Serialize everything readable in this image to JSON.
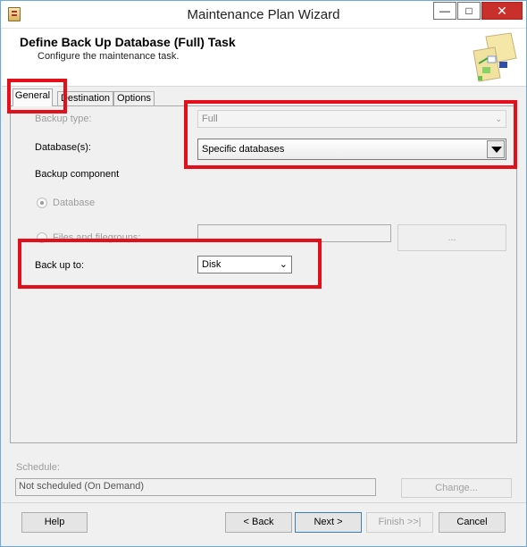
{
  "window": {
    "title": "Maintenance Plan Wizard",
    "minimize_glyph": "—",
    "maximize_glyph": "□",
    "close_glyph": "✕"
  },
  "header": {
    "title": "Define Back Up Database (Full) Task",
    "subtitle": "Configure the maintenance task."
  },
  "tabs": [
    {
      "label": "General",
      "selected": true
    },
    {
      "label": "Destination",
      "selected": false
    },
    {
      "label": "Options",
      "selected": false
    }
  ],
  "general": {
    "backup_type_label": "Backup type:",
    "backup_type_value": "Full",
    "databases_label": "Database(s):",
    "databases_value": "Specific databases",
    "backup_component_label": "Backup component",
    "component_database_label": "Database",
    "component_files_label": "Files and filegroups:",
    "files_value": "",
    "browse_label": "...",
    "backup_to_label": "Back up to:",
    "backup_to_value": "Disk"
  },
  "schedule": {
    "label": "Schedule:",
    "value": "Not scheduled (On Demand)",
    "change_label": "Change..."
  },
  "footer": {
    "help_label": "Help",
    "back_label": "< Back",
    "next_label": "Next >",
    "finish_label": "Finish >>|",
    "cancel_label": "Cancel"
  },
  "colors": {
    "highlight": "#e3101c",
    "window_border": "#6fa8dc",
    "close_button": "#c9302c"
  },
  "icons": [
    "app-icon",
    "wizard-graphic-icon",
    "dropdown-arrow-icon",
    "chevron-down-icon"
  ]
}
